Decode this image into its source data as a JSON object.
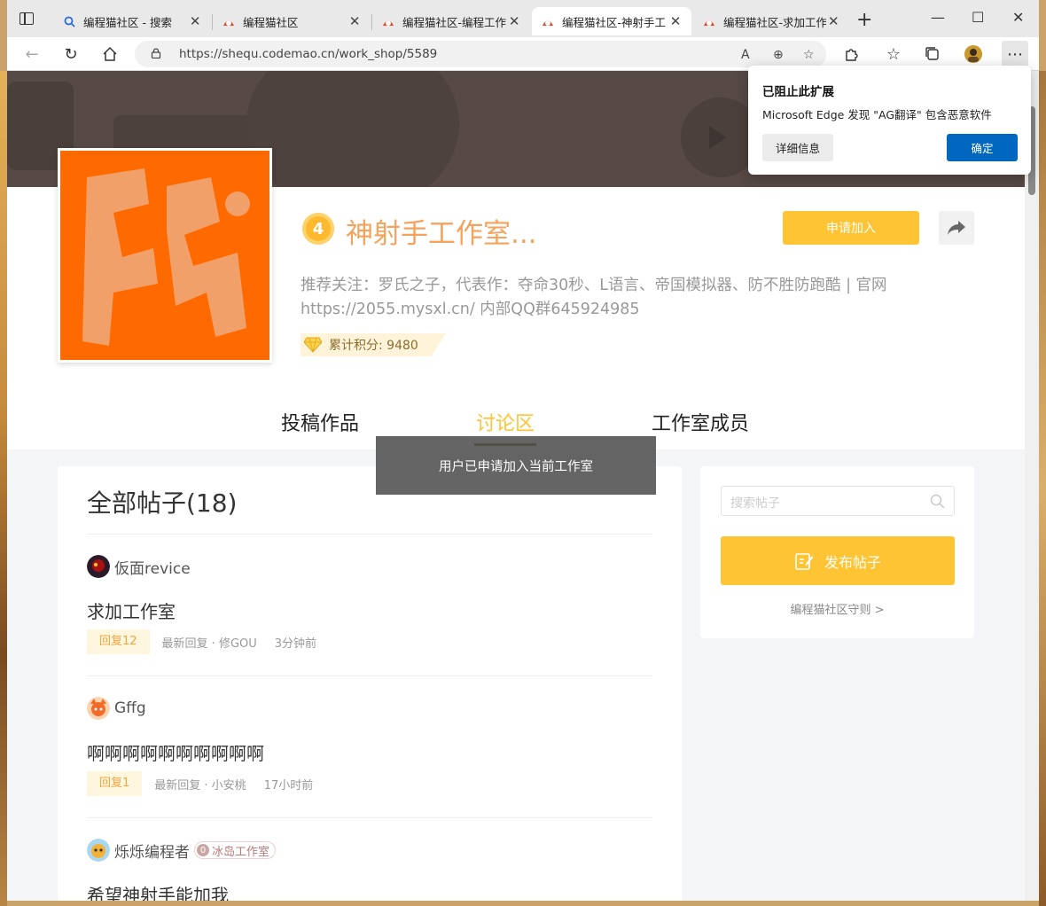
{
  "browser": {
    "tabs": [
      {
        "title": "编程猫社区 - 搜索",
        "active": false
      },
      {
        "title": "编程猫社区",
        "active": false
      },
      {
        "title": "编程猫社区-编程工作",
        "active": false
      },
      {
        "title": "编程猫社区-神射手工",
        "active": true
      },
      {
        "title": "编程猫社区-求加工作",
        "active": false
      }
    ],
    "url": "https://shequ.codemao.cn/work_shop/5589"
  },
  "popup": {
    "title": "已阻止此扩展",
    "message": "Microsoft Edge 发现 \"AG翻译\" 包含恶意软件",
    "details_label": "详细信息",
    "ok_label": "确定"
  },
  "studio": {
    "level": "4",
    "name": "神射手工作室...",
    "join_label": "申请加入",
    "description": "推荐关注：罗氏之子，代表作：夺命30秒、L语言、帝国模拟器、防不胜防跑酷 | 官网 https://2055.mysxl.cn/ 内部QQ群645924985",
    "score_label": "累计积分: 9480"
  },
  "nav_tabs": [
    {
      "label": "投稿作品",
      "active": false
    },
    {
      "label": "讨论区",
      "active": true
    },
    {
      "label": "工作室成员",
      "active": false
    }
  ],
  "toast": "用户已申请加入当前工作室",
  "posts_section": {
    "title": "全部帖子(18)",
    "posts": [
      {
        "user": "仮面revice",
        "title": "求加工作室",
        "replies": "回复12",
        "last_reply": "最新回复 · 修GOU",
        "time": "3分钟前"
      },
      {
        "user": "Gffg",
        "title": "啊啊啊啊啊啊啊啊啊啊",
        "replies": "回复1",
        "last_reply": "最新回复 · 小安桃",
        "time": "17小时前"
      },
      {
        "user": "烁烁编程者",
        "studio_level": "0",
        "studio_tag": "冰岛工作室",
        "title": "希望神射手能加我"
      }
    ]
  },
  "sidebar": {
    "search_placeholder": "搜索帖子",
    "post_button": "发布帖子",
    "rules_link": "编程猫社区守则 >"
  },
  "colors": {
    "accent": "#fec433",
    "studio_name": "#f5a35c",
    "edge_blue": "#0067c0"
  }
}
